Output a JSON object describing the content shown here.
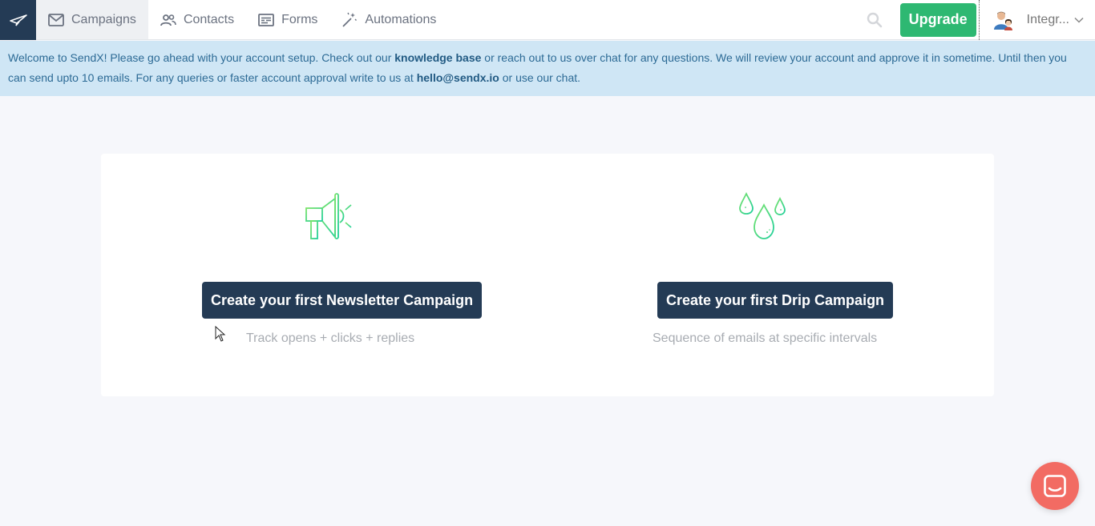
{
  "nav": {
    "items": [
      {
        "label": "Campaigns",
        "icon": "mail-icon"
      },
      {
        "label": "Contacts",
        "icon": "people-icon"
      },
      {
        "label": "Forms",
        "icon": "form-icon"
      },
      {
        "label": "Automations",
        "icon": "magic-wand-icon"
      }
    ],
    "upgrade_label": "Upgrade",
    "profile_name": "Integr..."
  },
  "notice": {
    "part1": "Welcome to SendX! Please go ahead with your account setup. Check out our ",
    "link1": "knowledge base",
    "part2": " or reach out to us over chat for any questions. We will review your account and approve it in sometime. Until then you can send upto 10 emails. For any queries or faster account approval write to us at ",
    "email": "hello@sendx.io",
    "part3": " or use our chat."
  },
  "cards": {
    "newsletter": {
      "button": "Create your first Newsletter Campaign",
      "subtitle": "Track opens + clicks + replies",
      "icon": "megaphone-icon"
    },
    "drip": {
      "button": "Create your first Drip Campaign",
      "subtitle": "Sequence of emails at specific intervals",
      "icon": "droplets-icon"
    }
  },
  "colors": {
    "navy": "#243b55",
    "green": "#2eb872",
    "banner_bg": "#cfe6f5",
    "chat": "#f26b63"
  }
}
